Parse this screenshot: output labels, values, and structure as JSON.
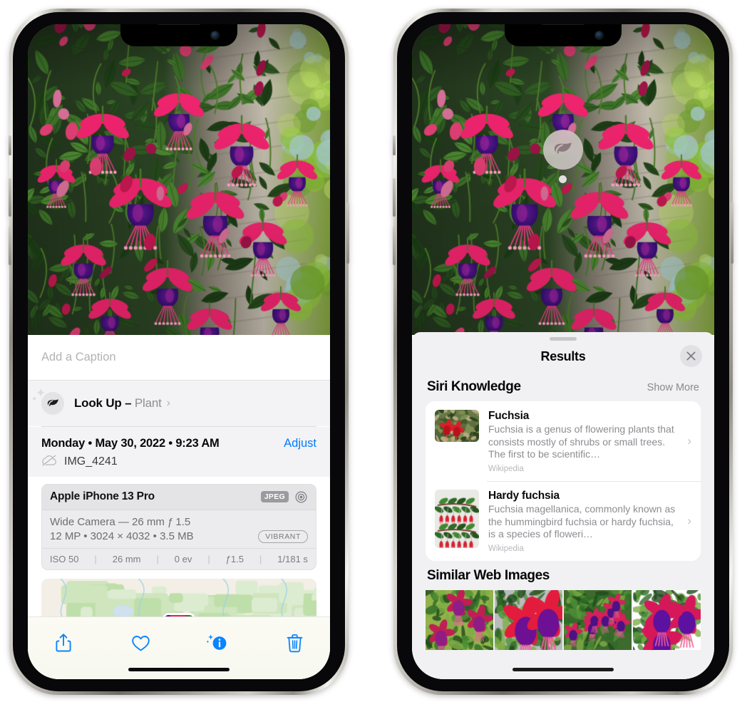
{
  "left_phone": {
    "photo": {
      "alt": "fuchsia-flowers-photo"
    },
    "caption_field": {
      "placeholder": "Add a Caption",
      "value": ""
    },
    "lookup_row": {
      "icon": "leaf-icon",
      "sparkle": "sparkle-icon",
      "label": "Look Up – ",
      "subject": "Plant",
      "chevron": "›"
    },
    "metadata": {
      "date": "Monday • May 30, 2022 • 9:23 AM",
      "adjust_label": "Adjust",
      "cloud_icon": "icloud-slash-icon",
      "filename": "IMG_4241"
    },
    "camera_card": {
      "device": "Apple iPhone 13 Pro",
      "format_badge": "JPEG",
      "raw_icon": "aperture-icon",
      "lens_line": "Wide Camera — 26 mm ƒ 1.5",
      "size_line": "12 MP • 3024 × 4032 • 3.5 MB",
      "style_badge": "VIBRANT",
      "exif": [
        "ISO 50",
        "26 mm",
        "0 ev",
        "ƒ1.5",
        "1/181 s"
      ]
    },
    "map": {
      "name": "location-map-thumbnail"
    },
    "toolbar": [
      {
        "name": "share-button",
        "icon": "share-icon"
      },
      {
        "name": "favorite-button",
        "icon": "heart-icon"
      },
      {
        "name": "info-button",
        "icon": "info-sparkle-icon"
      },
      {
        "name": "delete-button",
        "icon": "trash-icon"
      }
    ],
    "accent_color": "#007aff"
  },
  "right_phone": {
    "photo": {
      "alt": "fuchsia-flowers-photo"
    },
    "visual_lookup_badge": {
      "icon": "leaf-icon"
    },
    "sheet": {
      "title": "Results",
      "close_icon": "close-icon",
      "sections": [
        {
          "title": "Siri Knowledge",
          "action": "Show More",
          "items": [
            {
              "name": "Fuchsia",
              "description": "Fuchsia is a genus of flowering plants that consists mostly of shrubs or small trees. The first to be scientific…",
              "source": "Wikipedia",
              "chevron": "›"
            },
            {
              "name": "Hardy fuchsia",
              "description": "Fuchsia magellanica, commonly known as the hummingbird fuchsia or hardy fuchsia, is a species of floweri…",
              "source": "Wikipedia",
              "chevron": "›"
            }
          ]
        },
        {
          "title": "Similar Web Images",
          "images": [
            "fuchsia-web-image-1",
            "fuchsia-web-image-2",
            "fuchsia-web-image-3",
            "fuchsia-web-image-4"
          ]
        }
      ]
    }
  }
}
